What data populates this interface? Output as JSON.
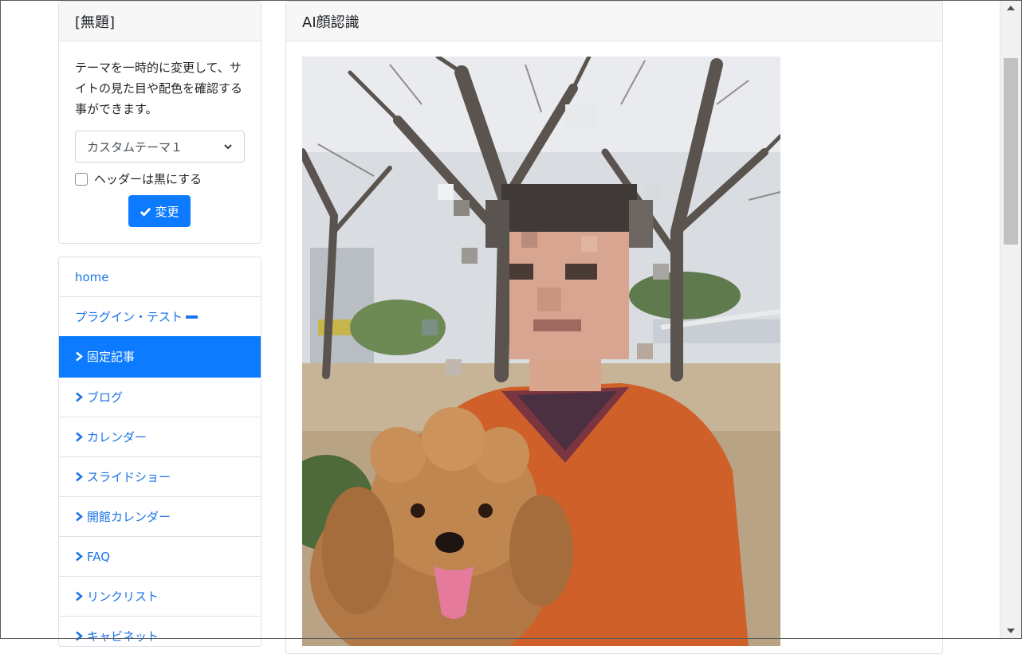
{
  "theme_widget": {
    "title": "[無題]",
    "description": "テーマを一時的に変更して、サイトの見た目や配色を確認する事ができます。",
    "select_value": "カスタムテーマ１",
    "checkbox_label": "ヘッダーは黒にする",
    "checkbox_checked": false,
    "apply_label": "変更"
  },
  "nav": {
    "items": [
      {
        "label": "home"
      },
      {
        "label": "プラグイン・テスト"
      },
      {
        "label": "固定記事"
      },
      {
        "label": "ブログ"
      },
      {
        "label": "カレンダー"
      },
      {
        "label": "スライドショー"
      },
      {
        "label": "開館カレンダー"
      },
      {
        "label": "FAQ"
      },
      {
        "label": "リンクリスト"
      },
      {
        "label": "キャビネット"
      }
    ],
    "active_index": 2
  },
  "main": {
    "title": "AI顔認識",
    "image": "Photo of a man in an orange sweater with pixelated (mosaic) face, holding a brown toy poodle, bare trees in a park behind"
  },
  "colors": {
    "accent": "#0d7bff",
    "link": "#1a73e8",
    "header_bg": "#f7f7f7",
    "border": "#dee2e6"
  }
}
